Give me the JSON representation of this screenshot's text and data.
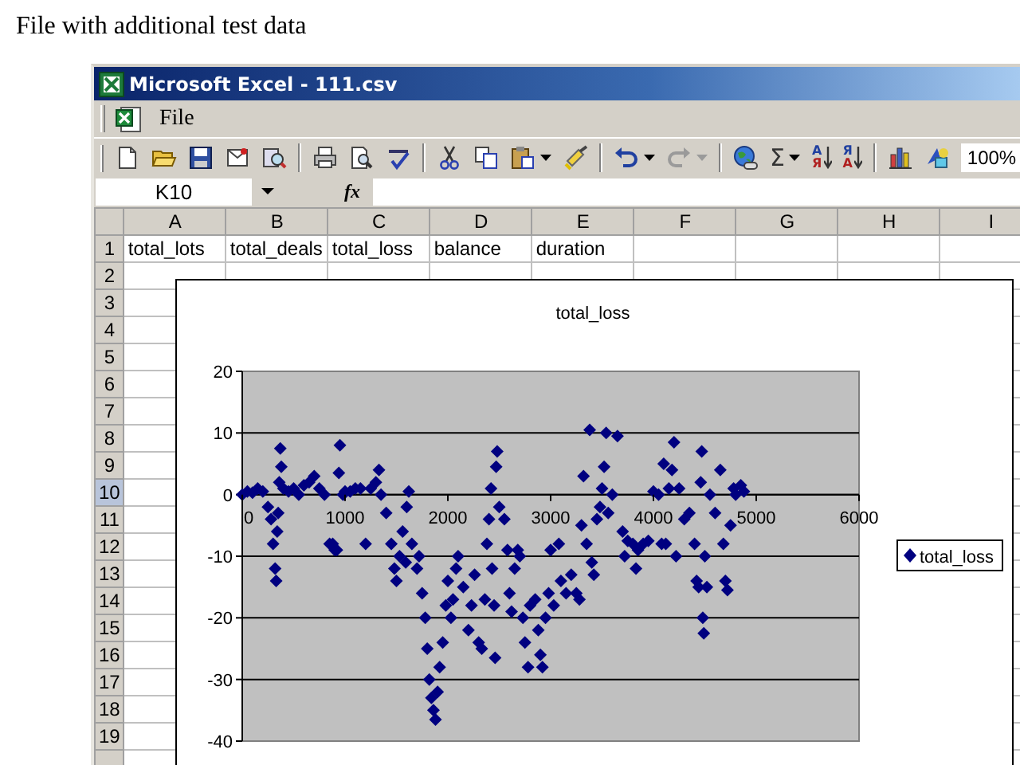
{
  "heading": "File with additional test data",
  "window": {
    "title": "Microsoft Excel - 111.csv"
  },
  "menu": [
    {
      "label": "File"
    }
  ],
  "toolbar": [
    {
      "kind": "new"
    },
    {
      "kind": "open"
    },
    {
      "kind": "save"
    },
    {
      "kind": "mail"
    },
    {
      "kind": "research"
    },
    {
      "kind": "separator"
    },
    {
      "kind": "print"
    },
    {
      "kind": "preview"
    },
    {
      "kind": "spelling"
    },
    {
      "kind": "separator"
    },
    {
      "kind": "cut"
    },
    {
      "kind": "copy"
    },
    {
      "kind": "paste"
    },
    {
      "kind": "dropdown",
      "disabled": false
    },
    {
      "kind": "painter"
    },
    {
      "kind": "separator"
    },
    {
      "kind": "undo",
      "disabled": false
    },
    {
      "kind": "dropdown",
      "disabled": false
    },
    {
      "kind": "redo",
      "disabled": true
    },
    {
      "kind": "dropdown",
      "disabled": true
    },
    {
      "kind": "separator"
    },
    {
      "kind": "hyperlink"
    },
    {
      "kind": "sum",
      "label": "Σ"
    },
    {
      "kind": "dropdown",
      "disabled": false
    },
    {
      "kind": "sort_ascending",
      "letters": [
        "А",
        "Я"
      ]
    },
    {
      "kind": "sort_descending",
      "letters": [
        "Я",
        "А"
      ]
    },
    {
      "kind": "separator"
    },
    {
      "kind": "chart"
    },
    {
      "kind": "drawing"
    },
    {
      "kind": "zoom",
      "value": "100%"
    }
  ],
  "formula_bar": {
    "name_box": "K10",
    "function_label": "fx"
  },
  "sheet": {
    "columns": [
      "A",
      "B",
      "C",
      "D",
      "E",
      "F",
      "G",
      "H",
      "I"
    ],
    "rows": [
      {
        "header": "1",
        "selected": false,
        "cells": [
          "total_lots",
          "total_deals",
          "total_loss",
          "balance",
          "duration"
        ]
      },
      {
        "header": "2",
        "selected": false
      },
      {
        "header": "3",
        "selected": false
      },
      {
        "header": "4",
        "selected": false
      },
      {
        "header": "5",
        "selected": false
      },
      {
        "header": "6",
        "selected": false
      },
      {
        "header": "7",
        "selected": false
      },
      {
        "header": "8",
        "selected": false
      },
      {
        "header": "9",
        "selected": false
      },
      {
        "header": "10",
        "selected": true
      },
      {
        "header": "11",
        "selected": false
      },
      {
        "header": "12",
        "selected": false
      },
      {
        "header": "13",
        "selected": false
      },
      {
        "header": "14",
        "selected": false
      },
      {
        "header": "15",
        "selected": false
      },
      {
        "header": "16",
        "selected": false
      },
      {
        "header": "17",
        "selected": false
      },
      {
        "header": "18",
        "selected": false
      },
      {
        "header": "19",
        "selected": false
      }
    ]
  },
  "chart": {
    "chart_data": {
      "type": "scatter",
      "title": "total_loss",
      "grid": true,
      "xlim": [
        0,
        6000
      ],
      "ylim": [
        -40,
        20
      ],
      "xticks": [
        0,
        1000,
        2000,
        3000,
        4000,
        5000,
        6000
      ],
      "yticks": [
        -40,
        -30,
        -20,
        -10,
        0,
        10,
        20
      ],
      "x": [
        0,
        50,
        100,
        150,
        200,
        250,
        280,
        300,
        320,
        330,
        340,
        350,
        360,
        370,
        380,
        400,
        450,
        500,
        550,
        600,
        650,
        700,
        750,
        800,
        850,
        880,
        900,
        920,
        940,
        950,
        980,
        1000,
        1050,
        1100,
        1150,
        1200,
        1250,
        1300,
        1330,
        1350,
        1400,
        1450,
        1480,
        1500,
        1530,
        1560,
        1590,
        1600,
        1620,
        1650,
        1700,
        1720,
        1750,
        1780,
        1800,
        1820,
        1840,
        1860,
        1880,
        1900,
        1920,
        1950,
        1980,
        2000,
        2030,
        2050,
        2080,
        2100,
        2150,
        2200,
        2230,
        2260,
        2300,
        2330,
        2360,
        2380,
        2400,
        2420,
        2430,
        2450,
        2460,
        2470,
        2480,
        2500,
        2550,
        2580,
        2600,
        2620,
        2650,
        2680,
        2700,
        2730,
        2750,
        2780,
        2800,
        2850,
        2880,
        2900,
        2920,
        2950,
        2980,
        3000,
        3030,
        3080,
        3100,
        3150,
        3200,
        3250,
        3280,
        3300,
        3320,
        3350,
        3380,
        3400,
        3420,
        3450,
        3480,
        3500,
        3520,
        3540,
        3560,
        3600,
        3650,
        3700,
        3720,
        3750,
        3800,
        3830,
        3850,
        3900,
        3950,
        4000,
        4050,
        4080,
        4100,
        4120,
        4150,
        4180,
        4200,
        4220,
        4250,
        4300,
        4350,
        4400,
        4420,
        4440,
        4460,
        4470,
        4480,
        4490,
        4500,
        4520,
        4550,
        4600,
        4650,
        4680,
        4700,
        4720,
        4750,
        4780,
        4800,
        4850,
        4880
      ],
      "series": [
        {
          "name": "total_loss",
          "color": "#000080",
          "values": [
            0,
            0.5,
            0.3,
            1,
            0.5,
            -2,
            -4,
            -8,
            -12,
            -14,
            -6,
            -3,
            2,
            7.5,
            4.5,
            1,
            0.5,
            1,
            0,
            1.5,
            2,
            3,
            1,
            0,
            -8,
            -8,
            -9,
            -9,
            3.5,
            8,
            0,
            0.5,
            0.5,
            1,
            1,
            -8,
            1,
            2,
            4,
            0,
            -3,
            -8,
            -12,
            -14,
            -10,
            -6,
            -11,
            -2,
            0.5,
            -8,
            -12,
            -10,
            -16,
            -20,
            -25,
            -30,
            -33,
            -35,
            -36.5,
            -32,
            -28,
            -24,
            -18,
            -14,
            -20,
            -17,
            -12,
            -10,
            -15,
            -22,
            -18,
            -13,
            -24,
            -25,
            -17,
            -8,
            -4,
            1,
            -12,
            -18,
            -26.5,
            4.5,
            7,
            -2,
            -4,
            -9,
            -16,
            -19,
            -12,
            -9,
            -10,
            -20,
            -24,
            -28,
            -18,
            -17,
            -22,
            -26,
            -28,
            -20,
            -16,
            -9,
            -18,
            -8,
            -14,
            -16,
            -13,
            -16,
            -17,
            -5,
            3,
            -8,
            10.5,
            -11,
            -13,
            -4,
            -2,
            1,
            4.5,
            10,
            -3,
            0,
            9.5,
            -6,
            -10,
            -7.5,
            -8,
            -12,
            -9,
            -8,
            -7.5,
            0.5,
            0,
            -8,
            5,
            -8,
            1,
            4,
            8.5,
            -10,
            1,
            -4,
            -3,
            -8,
            -14,
            -15,
            2,
            7,
            -20,
            -22.5,
            -10,
            -15,
            0,
            -3,
            4,
            -8,
            -14,
            -15.5,
            -5,
            1,
            0,
            1.5,
            0.5
          ]
        }
      ]
    }
  }
}
